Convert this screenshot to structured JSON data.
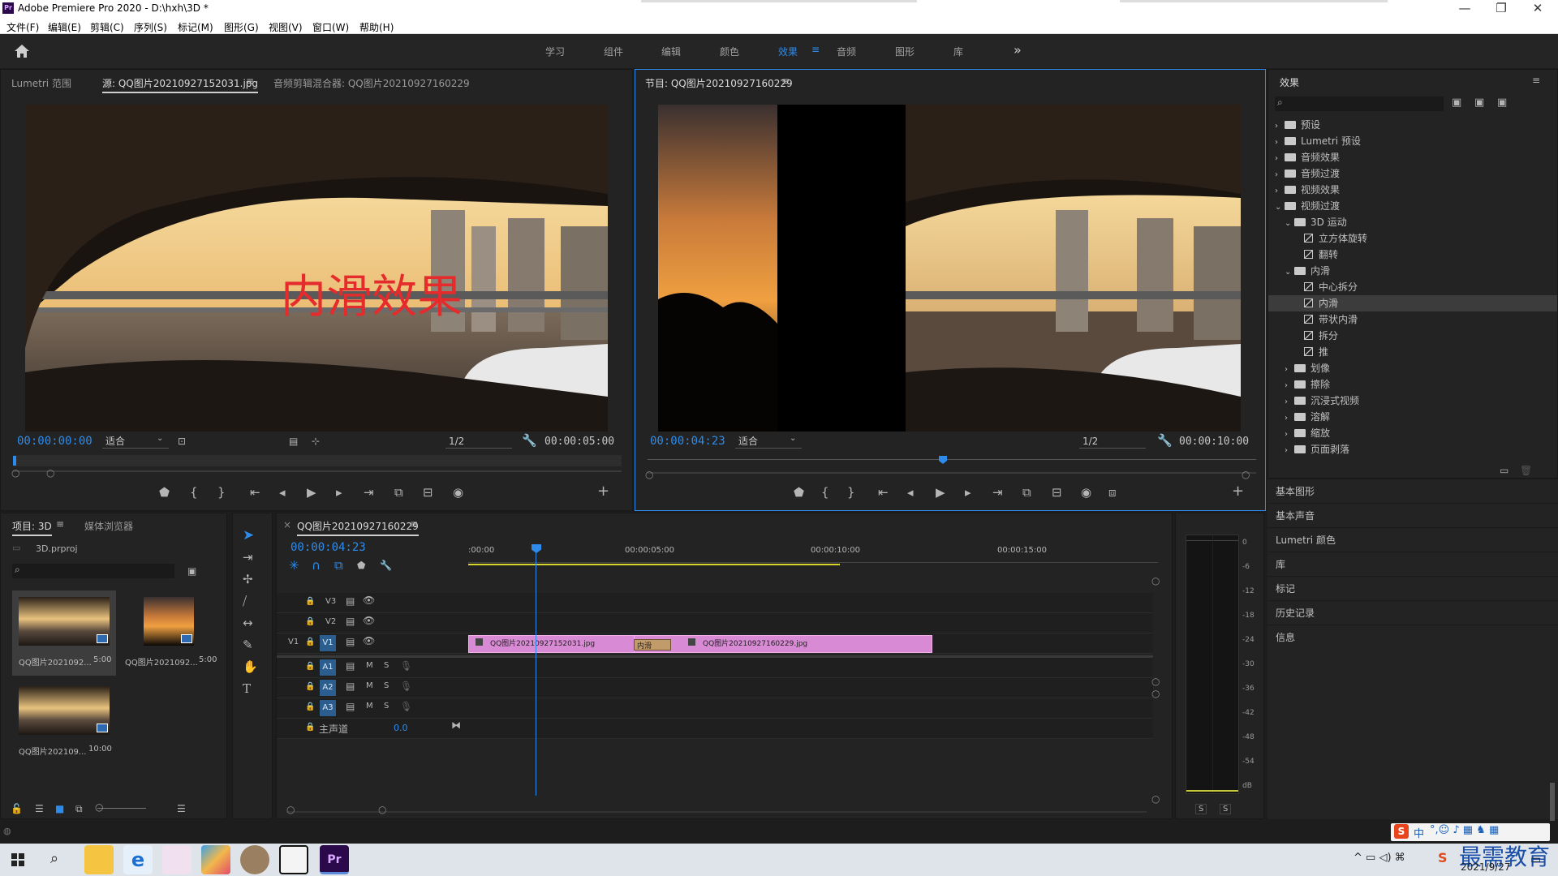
{
  "app": {
    "title": "Adobe Premiere Pro 2020 - D:\\hxh\\3D *",
    "icon": "Pr"
  },
  "window_controls": {
    "minimize": "—",
    "maximize": "❐",
    "close": "✕"
  },
  "menu": [
    "文件(F)",
    "编辑(E)",
    "剪辑(C)",
    "序列(S)",
    "标记(M)",
    "图形(G)",
    "视图(V)",
    "窗口(W)",
    "帮助(H)"
  ],
  "workspaces": [
    "学习",
    "组件",
    "编辑",
    "颜色",
    "效果",
    "音频",
    "图形",
    "库"
  ],
  "workspace_active": "效果",
  "workspace_more": "»",
  "source": {
    "tabs": [
      "Lumetri 范围",
      "源: QQ图片20210927152031.jpg",
      "音频剪辑混合器: QQ图片20210927160229"
    ],
    "overlay_text": "内滑效果",
    "timecode": "00:00:00:00",
    "fit": "适合",
    "resolution": "1/2",
    "duration": "00:00:05:00"
  },
  "program": {
    "tab": "节目: QQ图片20210927160229",
    "timecode": "00:00:04:23",
    "fit": "适合",
    "resolution": "1/2",
    "duration": "00:00:10:00"
  },
  "effects": {
    "title": "效果",
    "search_placeholder": "",
    "tree": [
      {
        "label": "预设",
        "level": 0,
        "kind": "folder",
        "open": false
      },
      {
        "label": "Lumetri 预设",
        "level": 0,
        "kind": "folder",
        "open": false
      },
      {
        "label": "音频效果",
        "level": 0,
        "kind": "folder",
        "open": false
      },
      {
        "label": "音频过渡",
        "level": 0,
        "kind": "folder",
        "open": false
      },
      {
        "label": "视频效果",
        "level": 0,
        "kind": "folder",
        "open": false
      },
      {
        "label": "视频过渡",
        "level": 0,
        "kind": "folder",
        "open": true
      },
      {
        "label": "3D 运动",
        "level": 1,
        "kind": "folder",
        "open": true
      },
      {
        "label": "立方体旋转",
        "level": 2,
        "kind": "fx"
      },
      {
        "label": "翻转",
        "level": 2,
        "kind": "fx"
      },
      {
        "label": "内滑",
        "level": 1,
        "kind": "folder",
        "open": true
      },
      {
        "label": "中心拆分",
        "level": 2,
        "kind": "fx"
      },
      {
        "label": "内滑",
        "level": 2,
        "kind": "fx",
        "selected": true
      },
      {
        "label": "带状内滑",
        "level": 2,
        "kind": "fx"
      },
      {
        "label": "拆分",
        "level": 2,
        "kind": "fx"
      },
      {
        "label": "推",
        "level": 2,
        "kind": "fx"
      },
      {
        "label": "划像",
        "level": 1,
        "kind": "folder",
        "open": false
      },
      {
        "label": "擦除",
        "level": 1,
        "kind": "folder",
        "open": false
      },
      {
        "label": "沉浸式视频",
        "level": 1,
        "kind": "folder",
        "open": false
      },
      {
        "label": "溶解",
        "level": 1,
        "kind": "folder",
        "open": false
      },
      {
        "label": "缩放",
        "level": 1,
        "kind": "folder",
        "open": false
      },
      {
        "label": "页面剥落",
        "level": 1,
        "kind": "folder",
        "open": false
      }
    ],
    "sections": [
      "基本图形",
      "基本声音",
      "Lumetri 颜色",
      "库",
      "标记",
      "历史记录",
      "信息"
    ]
  },
  "project": {
    "tabs": [
      "项目: 3D",
      "媒体浏览器"
    ],
    "file": "3D.prproj",
    "items": [
      {
        "name": "QQ图片2021092...",
        "duration": "5:00",
        "thumb": "car"
      },
      {
        "name": "QQ图片2021092...",
        "duration": "5:00",
        "thumb": "sunset"
      },
      {
        "name": "QQ图片202109...",
        "duration": "10:00",
        "thumb": "car"
      }
    ]
  },
  "timeline": {
    "tab": "QQ图片20210927160229",
    "timecode": "00:00:04:23",
    "ruler": [
      ":00:00",
      "00:00:05:00",
      "00:00:10:00",
      "00:00:15:00"
    ],
    "video_tracks": [
      "V3",
      "V2",
      "V1"
    ],
    "audio_tracks": [
      "A1",
      "A2",
      "A3"
    ],
    "source_patch": "V1",
    "master": {
      "label": "主声道",
      "value": "0.0"
    },
    "mute": "M",
    "solo": "S",
    "clips": [
      {
        "label": "QQ图片20210927152031.jpg",
        "track": "V1"
      },
      {
        "label": "QQ图片20210927160229.jpg",
        "track": "V1"
      }
    ],
    "transition": {
      "label": "内滑"
    }
  },
  "meter": {
    "scale": [
      "0",
      "-6",
      "-12",
      "-18",
      "-24",
      "-30",
      "-36",
      "-42",
      "-48",
      "-54",
      "dB"
    ],
    "solo": [
      "S",
      "S"
    ]
  },
  "taskbar": {
    "time": "",
    "date": "2021/9/27",
    "watermark": "最需教育",
    "ime": "中"
  }
}
